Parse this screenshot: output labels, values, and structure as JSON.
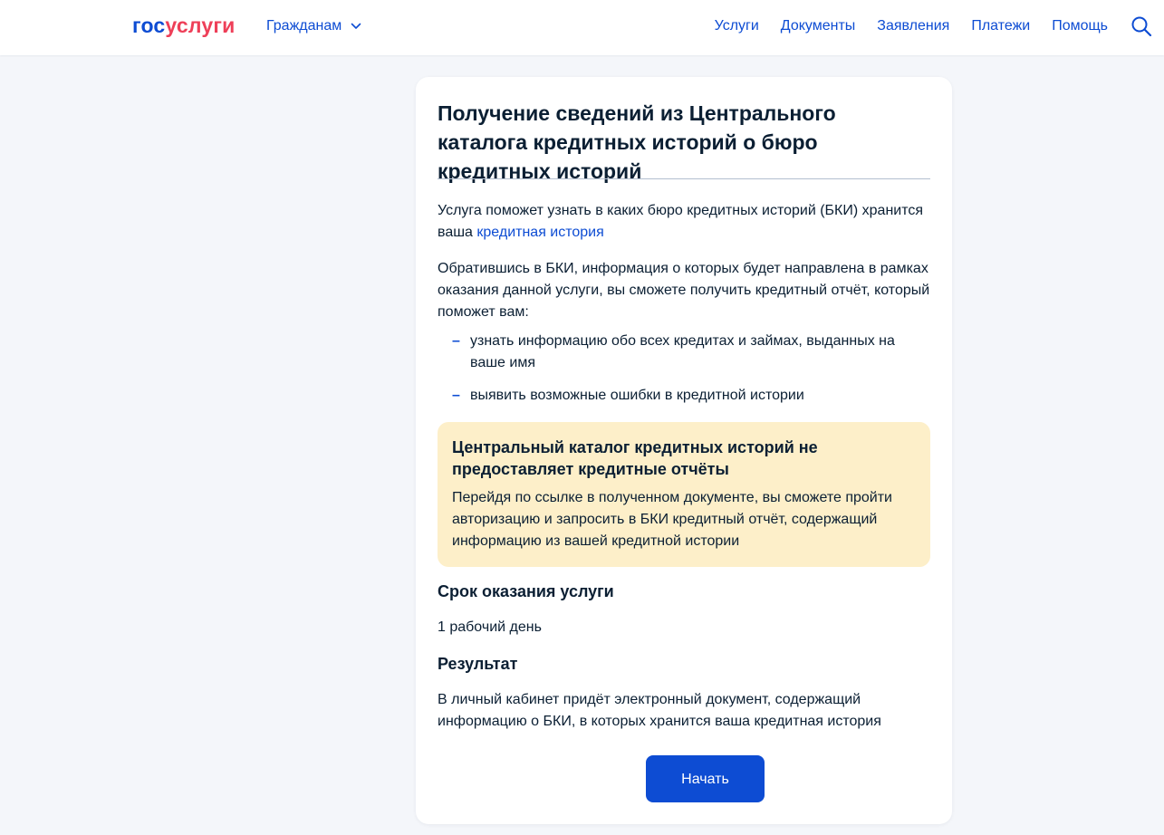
{
  "colors": {
    "brand_blue": "#0d4cd3",
    "brand_red": "#ee3f58",
    "page_bg": "#f4f6fa",
    "note_bg": "#fdefc9",
    "text": "#0b1f33"
  },
  "header": {
    "logo_part1": "гос",
    "logo_part2": "услуги",
    "audience": "Гражданам",
    "audience_icon": "chevron-down-icon",
    "nav": [
      "Услуги",
      "Документы",
      "Заявления",
      "Платежи",
      "Помощь"
    ],
    "search_icon": "search-icon"
  },
  "service": {
    "title": "Получение сведений из Центрального каталога кредитных историй о бюро кредитных историй",
    "intro_text": "Услуга поможет узнать в каких бюро кредитных историй (БКИ) хранится ваша",
    "intro_link": "кредитная история",
    "details_text": "Обратившись в БКИ, информация о которых будет направлена в рамках оказания данной услуги, вы сможете получить кредитный отчёт, который поможет вам:",
    "list": [
      "узнать информацию обо всех кредитах и займах, выданных на ваше имя",
      "выявить возможные ошибки в кредитной истории"
    ],
    "list_marker": "–",
    "note": {
      "title": "Центральный каталог кредитных историй не предоставляет кредитные отчёты",
      "text": "Перейдя по ссылке в полученном документе, вы сможете пройти авторизацию и запросить в БКИ кредитный отчёт, содержащий информацию из вашей кредитной истории"
    },
    "term_heading": "Срок оказания услуги",
    "term_value": "1 рабочий день",
    "result_heading": "Результат",
    "result_text": "В личный кабинет придёт электронный документ, содержащий информацию о БКИ, в которых хранится ваша кредитная история",
    "start_button": "Начать"
  }
}
